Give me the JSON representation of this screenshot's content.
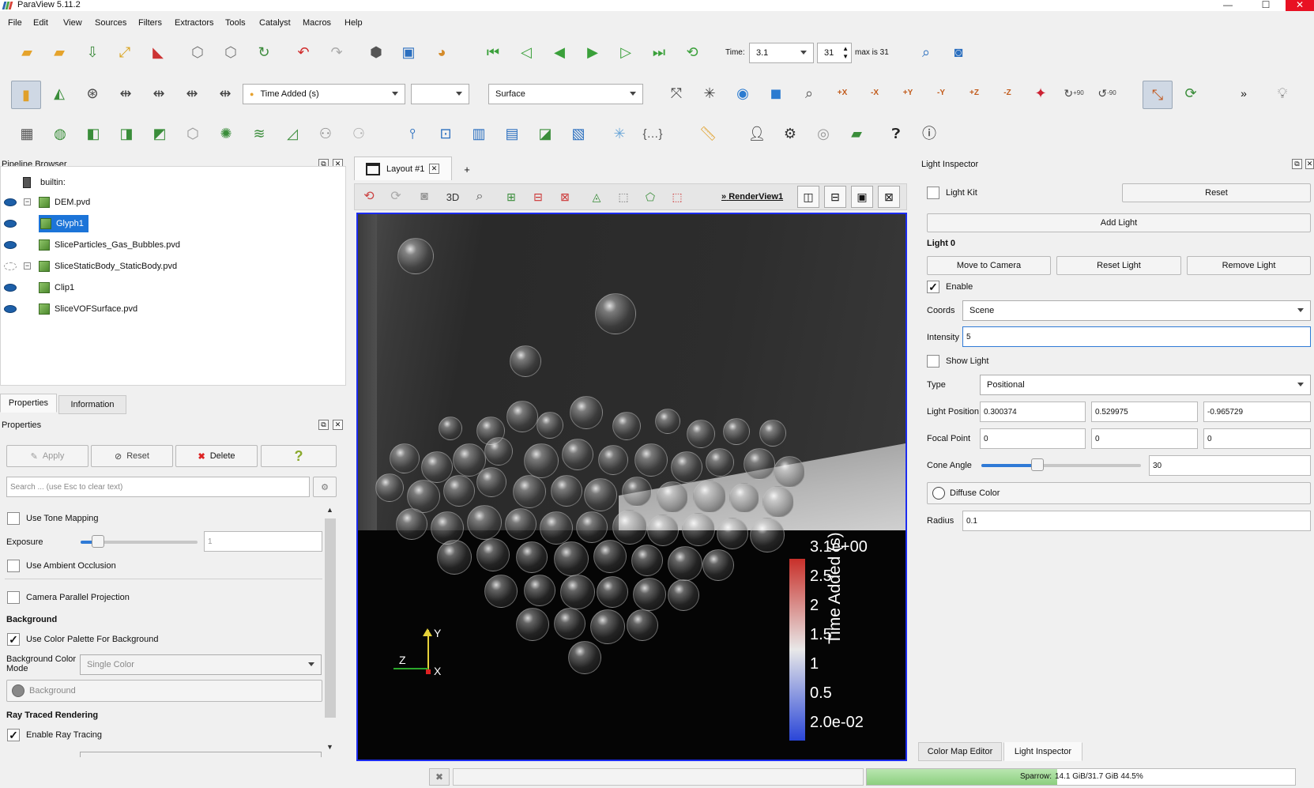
{
  "app": {
    "title": "ParaView 5.11.2"
  },
  "window_controls": {
    "minimize": "—",
    "maximize": "☐",
    "close": "✕"
  },
  "menu": [
    "File",
    "Edit",
    "View",
    "Sources",
    "Filters",
    "Extractors",
    "Tools",
    "Catalyst",
    "Macros",
    "Help"
  ],
  "time_bar": {
    "label": "Time:",
    "value": "3.1",
    "index": "31",
    "max_text": "max is 31"
  },
  "display_bar": {
    "color_by": "Time Added (s)",
    "component": "",
    "representation": "Surface",
    "more": "»"
  },
  "rotate_labels": {
    "cw": "+90",
    "ccw": "-90"
  },
  "axis_buttons": [
    "+X",
    "-X",
    "+Y",
    "-Y",
    "+Z",
    "-Z"
  ],
  "pipeline": {
    "title": "Pipeline Browser",
    "root": "builtin:",
    "items": [
      {
        "name": "DEM.pvd",
        "visible": true,
        "selected": false
      },
      {
        "name": "Glyph1",
        "visible": true,
        "selected": true
      },
      {
        "name": "SliceParticles_Gas_Bubbles.pvd",
        "visible": true,
        "selected": false
      },
      {
        "name": "SliceStaticBody_StaticBody.pvd",
        "visible": false,
        "selected": false
      },
      {
        "name": "Clip1",
        "visible": true,
        "selected": false
      },
      {
        "name": "SliceVOFSurface.pvd",
        "visible": true,
        "selected": false
      }
    ]
  },
  "properties": {
    "tabs": [
      "Properties",
      "Information"
    ],
    "title": "Properties",
    "buttons": {
      "apply": "Apply",
      "reset": "Reset",
      "delete": "Delete",
      "help": "?"
    },
    "search_placeholder": "Search ... (use Esc to clear text)",
    "use_tone_mapping": "Use Tone Mapping",
    "exposure_label": "Exposure",
    "exposure_value": "1",
    "use_ambient_occlusion": "Use Ambient Occlusion",
    "camera_parallel": "Camera Parallel Projection",
    "background_heading": "Background",
    "use_color_palette": "Use Color Palette For Background",
    "bg_color_mode_label": "Background Color Mode",
    "bg_color_mode_value": "Single Color",
    "background_button": "Background",
    "ray_traced_heading": "Ray Traced Rendering",
    "enable_ray_tracing": "Enable Ray Tracing"
  },
  "layout": {
    "tab": "Layout #1",
    "add": "+",
    "btn_3d": "3D",
    "view_name": "RenderView1",
    "view_prefix": "»"
  },
  "color_legend": {
    "title": "Time Added (s)",
    "ticks": [
      "3.1e+00",
      "2.5",
      "2",
      "1.5",
      "1",
      "0.5",
      "2.0e-02"
    ],
    "colors": {
      "high": "#c8302a",
      "mid": "#e8e8e8",
      "low": "#2a46d8"
    }
  },
  "axes": {
    "y": "Y",
    "z": "Z",
    "x": "X"
  },
  "light_inspector": {
    "title": "Light Inspector",
    "light_kit": "Light Kit",
    "reset": "Reset",
    "add_light": "Add Light",
    "light_heading": "Light 0",
    "move_to_camera": "Move to Camera",
    "reset_light": "Reset Light",
    "remove_light": "Remove Light",
    "enable": "Enable",
    "coords_label": "Coords",
    "coords_value": "Scene",
    "intensity_label": "Intensity",
    "intensity_value": "5",
    "show_light": "Show Light",
    "type_label": "Type",
    "type_value": "Positional",
    "light_position_label": "Light Position",
    "light_position": [
      "0.300374",
      "0.529975",
      "-0.965729"
    ],
    "focal_point_label": "Focal Point",
    "focal_point": [
      "0",
      "0",
      "0"
    ],
    "cone_angle_label": "Cone Angle",
    "cone_angle_value": "30",
    "cone_angle_fraction": 0.35,
    "diffuse_color": "Diffuse Color",
    "radius_label": "Radius",
    "radius_value": "0.1"
  },
  "bottom_tabs": [
    "Color Map Editor",
    "Light Inspector"
  ],
  "status": {
    "memory_label": "Sparrow:",
    "memory_value": "14.1 GiB/31.7 GiB 44.5%",
    "memory_fraction": 0.445
  }
}
